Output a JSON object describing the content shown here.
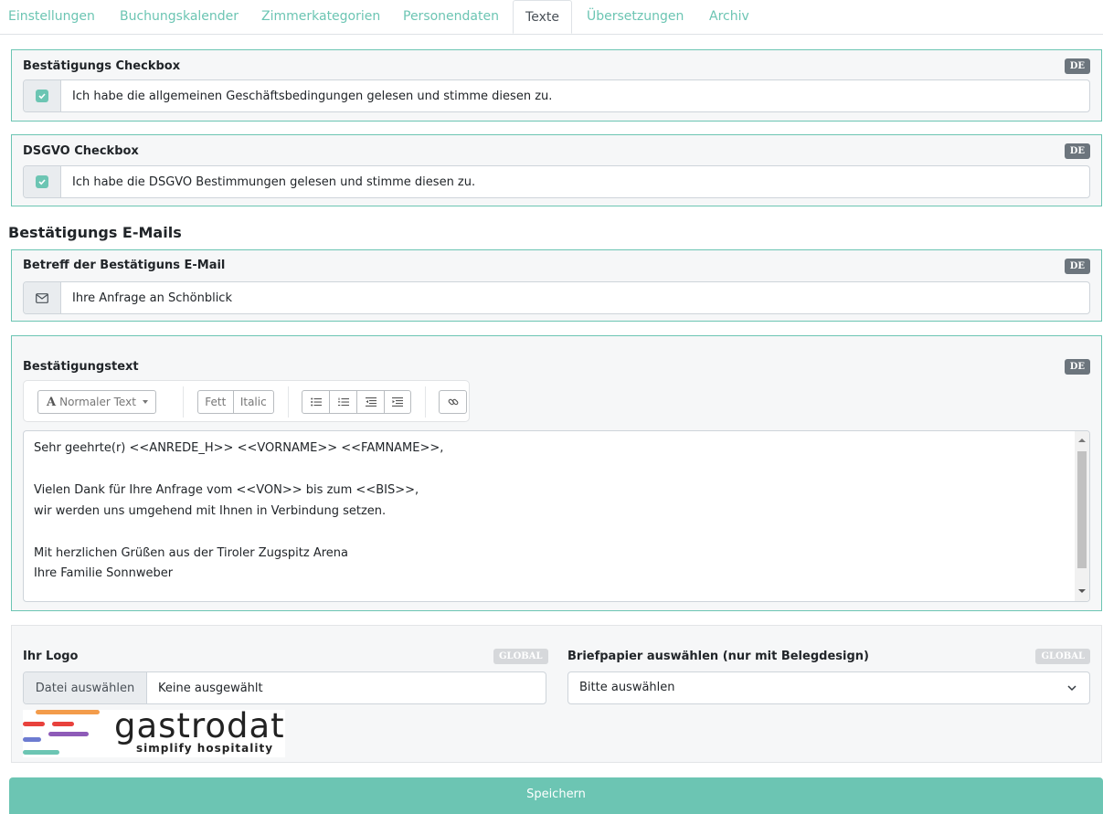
{
  "tabs": [
    {
      "label": "Einstellungen"
    },
    {
      "label": "Buchungskalender"
    },
    {
      "label": "Zimmerkategorien"
    },
    {
      "label": "Personendaten"
    },
    {
      "label": "Texte"
    },
    {
      "label": "Übersetzungen"
    },
    {
      "label": "Archiv"
    }
  ],
  "active_tab": "Texte",
  "confirm_checkbox": {
    "title": "Bestätigungs Checkbox",
    "lang": "DE",
    "text": "Ich habe die allgemeinen Geschäftsbedingungen gelesen und stimme diesen zu."
  },
  "dsgvo_checkbox": {
    "title": "DSGVO Checkbox",
    "lang": "DE",
    "text": "Ich habe die DSGVO Bestimmungen gelesen und stimme diesen zu."
  },
  "emails_heading": "Bestätigungs E-Mails",
  "subject": {
    "title": "Betreff der Bestätiguns E-Mail",
    "lang": "DE",
    "value": "Ihre Anfrage an Schönblick"
  },
  "body_text": {
    "title": "Bestätigungstext",
    "lang": "DE",
    "toolbar": {
      "style_label": "Normaler Text",
      "bold_label": "Fett",
      "italic_label": "Italic"
    },
    "lines": [
      "Sehr geehrte(r) <<ANREDE_H>> <<VORNAME>> <<FAMNAME>>,",
      "",
      "Vielen Dank für Ihre Anfrage vom <<VON>> bis zum <<BIS>>,",
      "wir werden uns umgehend mit Ihnen in Verbindung setzen.",
      "",
      "Mit herzlichen Grüßen aus der Tiroler Zugspitz Arena",
      "Ihre Familie Sonnweber"
    ]
  },
  "logo": {
    "label": "Ihr Logo",
    "scope": "GLOBAL",
    "file_button": "Datei auswählen",
    "file_name": "Keine ausgewählt",
    "brand_name": "gastrodat",
    "brand_tagline": "simplify hospitality"
  },
  "letterhead": {
    "label": "Briefpapier auswählen (nur mit Belegdesign)",
    "scope": "GLOBAL",
    "selected": "Bitte auswählen"
  },
  "save_label": "Speichern",
  "colors": {
    "accent": "#6cc5b3",
    "badge": "#6c757d"
  }
}
